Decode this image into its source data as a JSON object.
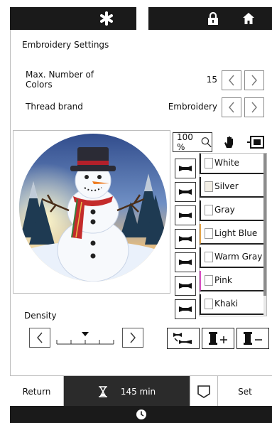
{
  "top_bar": {
    "settings_icon": "asterisk-icon",
    "lock_icon": "lock-icon",
    "home_icon": "home-icon"
  },
  "page_title": "Embroidery Settings",
  "max_colors": {
    "label": "Max. Number of Colors",
    "value": "15"
  },
  "thread_brand": {
    "label": "Thread brand",
    "value": "Embroidery"
  },
  "zoom": {
    "value": "100 %"
  },
  "colors": [
    {
      "name": "White",
      "hex": "#ffffff"
    },
    {
      "name": "Silver",
      "hex": "#f3efe6"
    },
    {
      "name": "Gray",
      "hex": "#ffffff"
    },
    {
      "name": "Light Blue",
      "hex": "#ffffff"
    },
    {
      "name": "Warm Gray",
      "hex": "#ffffff"
    },
    {
      "name": "Pink",
      "hex": "#ffffff"
    },
    {
      "name": "Khaki",
      "hex": "#ffffff"
    }
  ],
  "color_row_accents": [
    "#222222",
    "#222222",
    "#222222",
    "#e0a34a",
    "#222222",
    "#d64fc0",
    "#222222"
  ],
  "density": {
    "label": "Density",
    "level": 0.5
  },
  "bottom": {
    "return_label": "Return",
    "time_label": "145 min",
    "set_label": "Set"
  },
  "colors_theme": {
    "dark": "#1a1a1a",
    "time_bg": "#2b2b2b"
  }
}
